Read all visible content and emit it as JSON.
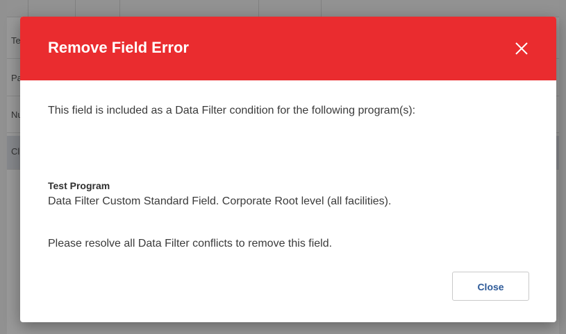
{
  "background": {
    "rows": [
      {
        "text": "Te"
      },
      {
        "text": "Pa"
      },
      {
        "text": "Nu"
      },
      {
        "text": "Cl"
      }
    ]
  },
  "dialog": {
    "title": "Remove Field Error",
    "close_icon": "close-x-icon",
    "intro": "This field is included as a Data Filter condition for the following program(s):",
    "program_name": "Test Program",
    "program_desc": "Data Filter Custom Standard Field. Corporate Root level (all facilities).",
    "resolve": "Please resolve all Data Filter conflicts to remove this field.",
    "close_button": "Close"
  },
  "colors": {
    "header": "#ea2c2f",
    "button_text": "#2d5a98"
  }
}
